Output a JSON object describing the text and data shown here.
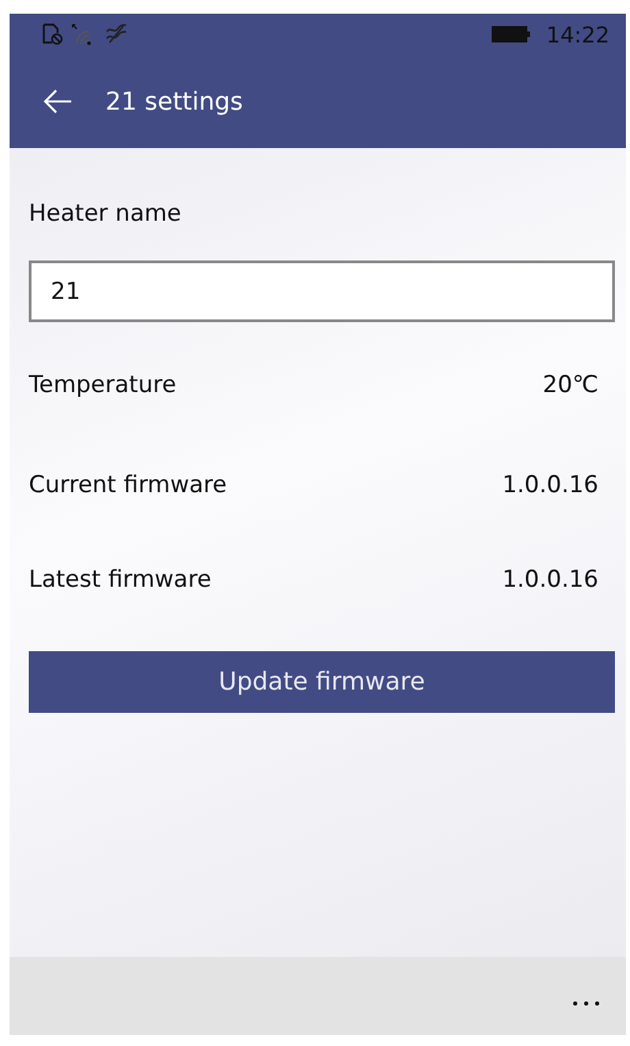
{
  "status_bar": {
    "time": "14:22"
  },
  "header": {
    "title": "21 settings"
  },
  "heater_name": {
    "label": "Heater name",
    "value": "21"
  },
  "info_rows": [
    {
      "label": "Temperature",
      "value": "20℃"
    },
    {
      "label": "Current firmware",
      "value": "1.0.0.16"
    },
    {
      "label": "Latest firmware",
      "value": "1.0.0.16"
    }
  ],
  "update_button": {
    "label": "Update firmware"
  }
}
